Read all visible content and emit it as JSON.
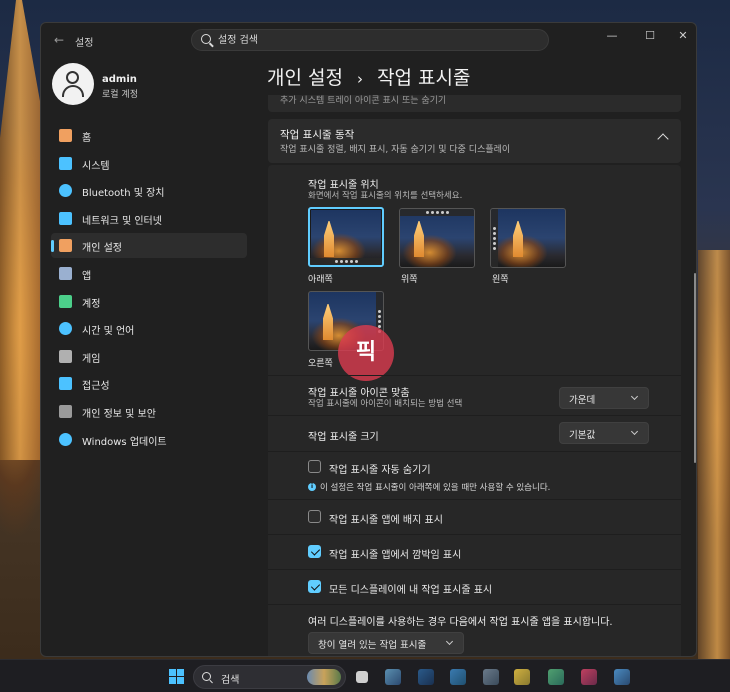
{
  "window": {
    "app_title": "설정",
    "search_placeholder": "설정 검색",
    "controls": {
      "minimize": "—",
      "maximize": "☐",
      "close": "✕"
    }
  },
  "profile": {
    "name": "admin",
    "subtitle": "로컬 계정"
  },
  "nav": {
    "items": [
      {
        "label": "홈",
        "icon": "home-icon",
        "color": "#f0a060"
      },
      {
        "label": "시스템",
        "icon": "monitor-icon",
        "color": "#4cc2ff"
      },
      {
        "label": "Bluetooth 및 장치",
        "icon": "bluetooth-icon",
        "color": "#4cc2ff"
      },
      {
        "label": "네트워크 및 인터넷",
        "icon": "wifi-icon",
        "color": "#4cc2ff"
      },
      {
        "label": "개인 설정",
        "icon": "brush-icon",
        "color": "#f0a060",
        "active": true
      },
      {
        "label": "앱",
        "icon": "apps-icon",
        "color": "#9ab0d0"
      },
      {
        "label": "계정",
        "icon": "person-icon",
        "color": "#4ccf8a"
      },
      {
        "label": "시간 및 언어",
        "icon": "globe-clock-icon",
        "color": "#4cc2ff"
      },
      {
        "label": "게임",
        "icon": "gamepad-icon",
        "color": "#b0b0b0"
      },
      {
        "label": "접근성",
        "icon": "accessibility-icon",
        "color": "#4cc2ff"
      },
      {
        "label": "개인 정보 및 보안",
        "icon": "shield-icon",
        "color": "#9a9a9a"
      },
      {
        "label": "Windows 업데이트",
        "icon": "update-icon",
        "color": "#4cc2ff"
      }
    ]
  },
  "page": {
    "breadcrumb_parent": "개인 설정",
    "breadcrumb_sep": "›",
    "breadcrumb_current": "작업 표시줄"
  },
  "prev_card_text": "추가 시스템 트레이 아이콘 표시 또는 숨기기",
  "behaviors": {
    "title": "작업 표시줄 동작",
    "desc": "작업 표시줄 정렬, 배지 표시, 자동 숨기기 및 다중 디스플레이"
  },
  "position": {
    "title": "작업 표시줄 위치",
    "desc": "화면에서 작업 표시줄의 위치를 선택하세요.",
    "options": [
      {
        "label": "아래쪽",
        "selected": true
      },
      {
        "label": "위쪽"
      },
      {
        "label": "왼쪽"
      },
      {
        "label": "오른쪽"
      }
    ]
  },
  "watermark": "픽",
  "alignment": {
    "title": "작업 표시줄 아이콘 맞춤",
    "desc": "작업 표시줄에 아이콘이 배치되는 방법 선택",
    "value": "가운데"
  },
  "size": {
    "title": "작업 표시줄 크기",
    "value": "기본값"
  },
  "checks": {
    "autohide": {
      "label": "작업 표시줄 자동 숨기기",
      "checked": false
    },
    "autohide_info": "이 설정은 작업 표시줄이 아래쪽에 있을 때만 사용할 수 있습니다.",
    "badges": {
      "label": "작업 표시줄 앱에 배지 표시",
      "checked": false
    },
    "flashing": {
      "label": "작업 표시줄 앱에서 깜박임 표시",
      "checked": true
    },
    "all_displays": {
      "label": "모든 디스플레이에 내 작업 표시줄 표시",
      "checked": true
    }
  },
  "multi_display": {
    "desc": "여러 디스플레이를 사용하는 경우 다음에서 작업 표시줄 앱을 표시합니다.",
    "value": "창이 열려 있는 작업 표시줄"
  },
  "taskbar": {
    "search_label": "검색"
  }
}
